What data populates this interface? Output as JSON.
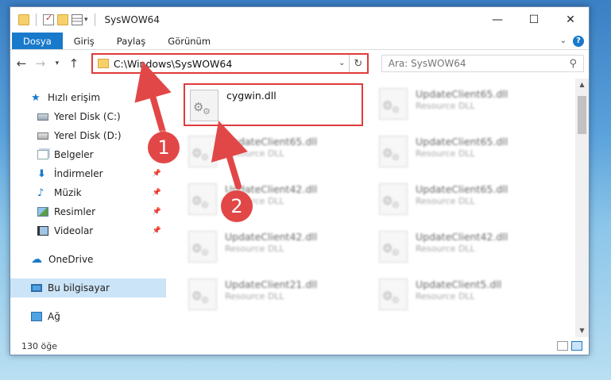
{
  "window": {
    "title": "SysWOW64"
  },
  "titlebar": {
    "minimize": "—",
    "maximize": "☐",
    "close": "✕"
  },
  "ribbon": {
    "tabs": [
      "Dosya",
      "Giriş",
      "Paylaş",
      "Görünüm"
    ]
  },
  "address": {
    "path": "C:\\Windows\\SysWOW64",
    "search_placeholder": "Ara: SysWOW64"
  },
  "sidebar": {
    "items": [
      {
        "label": "Hızlı erişim",
        "icon": "star-icon",
        "pinned": false
      },
      {
        "label": "Yerel Disk (C:)",
        "icon": "drive-icon",
        "pinned": false
      },
      {
        "label": "Yerel Disk (D:)",
        "icon": "drive-icon",
        "pinned": false
      },
      {
        "label": "Belgeler",
        "icon": "documents-icon",
        "pinned": false
      },
      {
        "label": "İndirmeler",
        "icon": "download-icon",
        "pinned": true
      },
      {
        "label": "Müzik",
        "icon": "music-icon",
        "pinned": true
      },
      {
        "label": "Resimler",
        "icon": "pictures-icon",
        "pinned": true
      },
      {
        "label": "Videolar",
        "icon": "video-icon",
        "pinned": true
      },
      {
        "label": "OneDrive",
        "icon": "cloud-icon",
        "pinned": false
      },
      {
        "label": "Bu bilgisayar",
        "icon": "computer-icon",
        "pinned": false
      },
      {
        "label": "Ağ",
        "icon": "network-icon",
        "pinned": false
      }
    ]
  },
  "files": [
    {
      "name": "cygwin.dll",
      "type": ""
    },
    {
      "name": "UpdateClient65.dll",
      "type": "Resource DLL"
    },
    {
      "name": "UpdateClient65.dll",
      "type": "Resource DLL"
    },
    {
      "name": "UpdateClient65.dll",
      "type": "Resource DLL"
    },
    {
      "name": "UpdateClient42.dll",
      "type": "Resource DLL"
    },
    {
      "name": "UpdateClient65.dll",
      "type": "Resource DLL"
    },
    {
      "name": "UpdateClient42.dll",
      "type": "Resource DLL"
    },
    {
      "name": "UpdateClient42.dll",
      "type": "Resource DLL"
    },
    {
      "name": "UpdateClient21.dll",
      "type": "Resource DLL"
    },
    {
      "name": "UpdateClient5.dll",
      "type": "Resource DLL"
    }
  ],
  "status": {
    "count": "130 öğe"
  },
  "annotations": {
    "step1": "1",
    "step2": "2",
    "color": "#e24747"
  }
}
